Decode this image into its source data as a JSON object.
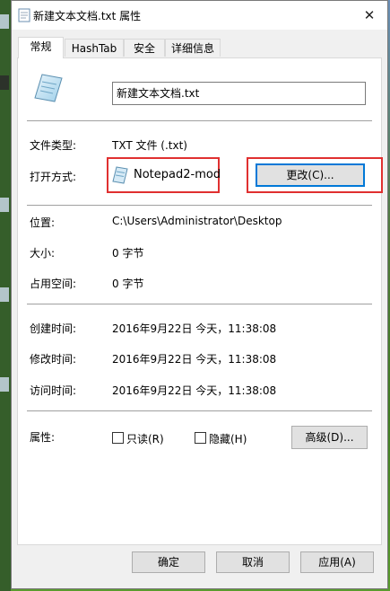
{
  "window": {
    "title": "新建文本文档.txt 属性",
    "close_glyph": "✕"
  },
  "tabs": [
    {
      "label": "常规",
      "active": true
    },
    {
      "label": "HashTab",
      "active": false
    },
    {
      "label": "安全",
      "active": false
    },
    {
      "label": "详细信息",
      "active": false
    }
  ],
  "general": {
    "file_name": "新建文本文档.txt",
    "file_type_label": "文件类型:",
    "file_type_value": "TXT 文件 (.txt)",
    "opens_with_label": "打开方式:",
    "opens_with_value": "Notepad2-mod",
    "change_button": "更改(C)...",
    "location_label": "位置:",
    "location_value": "C:\\Users\\Administrator\\Desktop",
    "size_label": "大小:",
    "size_value": "0 字节",
    "size_on_disk_label": "占用空间:",
    "size_on_disk_value": "0 字节",
    "created_label": "创建时间:",
    "created_value": "2016年9月22日 今天，11:38:08",
    "modified_label": "修改时间:",
    "modified_value": "2016年9月22日 今天，11:38:08",
    "accessed_label": "访问时间:",
    "accessed_value": "2016年9月22日 今天，11:38:08",
    "attributes_label": "属性:",
    "readonly_label": "只读(R)",
    "hidden_label": "隐藏(H)",
    "advanced_button": "高级(D)..."
  },
  "footer": {
    "ok": "确定",
    "cancel": "取消",
    "apply": "应用(A)"
  },
  "colors": {
    "highlight_box": "#e03030",
    "focus_border": "#0078d7"
  }
}
